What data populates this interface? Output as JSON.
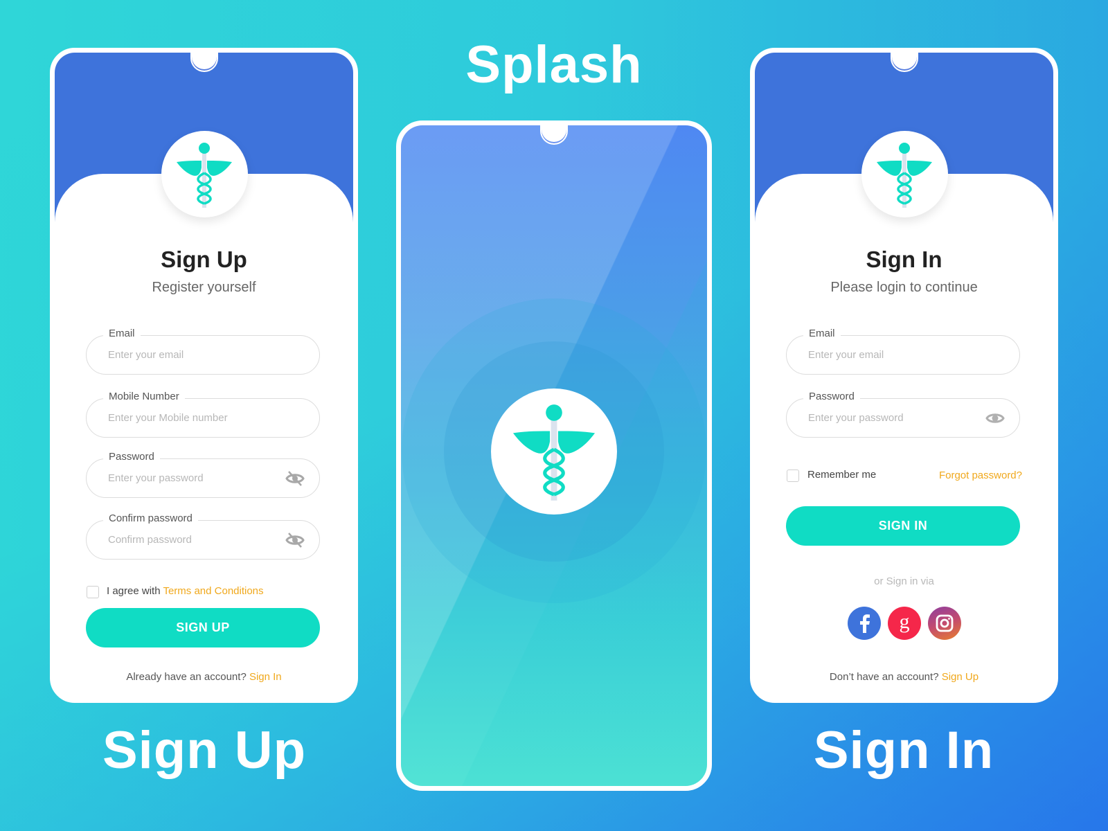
{
  "labels": {
    "splash": "Splash",
    "sign_up": "Sign Up",
    "sign_in": "Sign In"
  },
  "colors": {
    "header_blue": "#3e73db",
    "accent_teal": "#10dcc4",
    "link_orange": "#f0a81c",
    "facebook": "#3e73db",
    "google": "#f5274a"
  },
  "icons": {
    "logo": "caduceus-icon",
    "password_hidden": "eye-off-icon",
    "password_visible": "eye-icon",
    "social": [
      "facebook-icon",
      "google-icon",
      "instagram-icon"
    ]
  },
  "signup": {
    "title": "Sign Up",
    "subtitle": "Register yourself",
    "fields": [
      {
        "label": "Email",
        "placeholder": "Enter your email",
        "value": ""
      },
      {
        "label": "Mobile Number",
        "placeholder": "Enter your Mobile number",
        "value": ""
      },
      {
        "label": "Password",
        "placeholder": "Enter your password",
        "value": ""
      },
      {
        "label": "Confirm password",
        "placeholder": "Confirm password",
        "value": ""
      }
    ],
    "agree_text": "I agree with ",
    "terms_link": "Terms and Conditions",
    "agree_checked": false,
    "button": "SIGN UP",
    "footer_text": "Already have an account? ",
    "footer_link": "Sign In"
  },
  "signin": {
    "title": "Sign In",
    "subtitle": "Please login to continue",
    "fields": [
      {
        "label": "Email",
        "placeholder": "Enter your email",
        "value": ""
      },
      {
        "label": "Password",
        "placeholder": "Enter your password",
        "value": ""
      }
    ],
    "remember_label": "Remember me",
    "remember_checked": false,
    "forgot_link": "Forgot password?",
    "button": "SIGN IN",
    "social_prompt": "or Sign in via",
    "footer_text": "Don’t have an account? ",
    "footer_link": "Sign Up"
  }
}
